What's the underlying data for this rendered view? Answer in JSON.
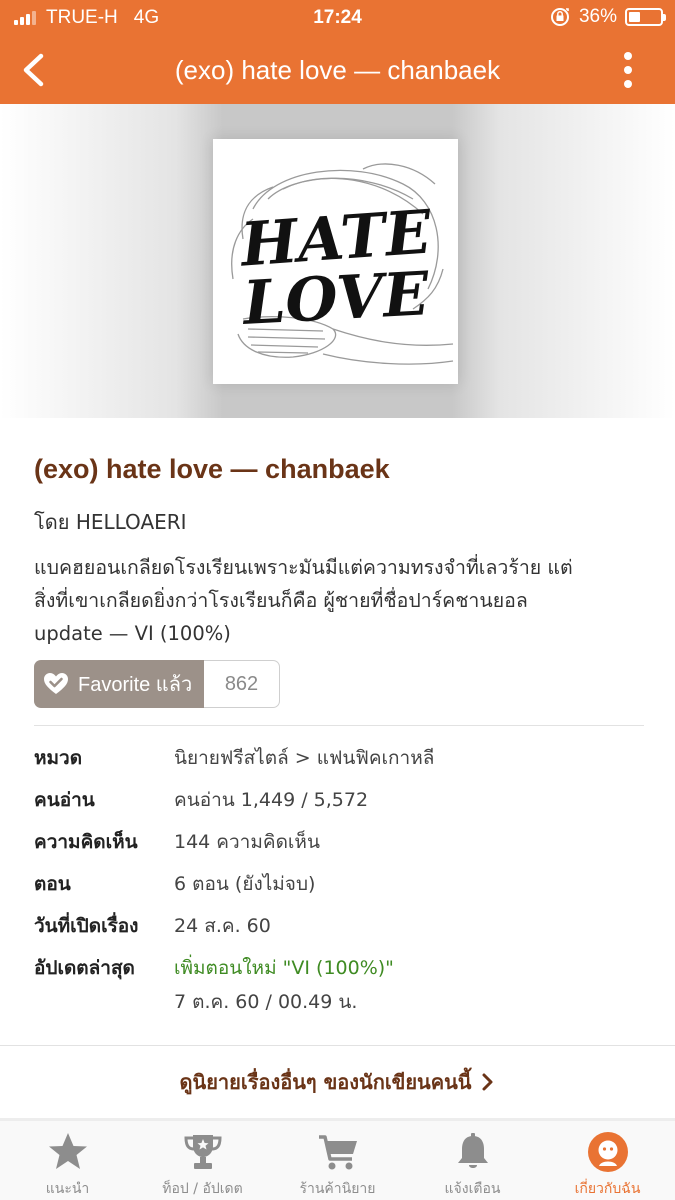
{
  "status_bar": {
    "carrier": "TRUE-H",
    "network": "4G",
    "time": "17:24",
    "battery": "36%",
    "battery_level": 0.36
  },
  "nav": {
    "title": "(exo) hate love — chanbaek",
    "back_icon": "chevron-left-icon",
    "more_icon": "more-vertical-icon"
  },
  "novel": {
    "title": "(exo) hate love — chanbaek",
    "author_prefix": "โดย",
    "author": "HELLOAERI",
    "synopsis_line1": "แบคฮยอนเกลียดโรงเรียนเพราะมันมีแต่ความทรงจำที่เลวร้าย แต่",
    "synopsis_line2": "สิ่งที่เขาเกลียดยิ่งกว่าโรงเรียนก็คือ ผู้ชายที่ชื่อปาร์คชานยอล",
    "synopsis_line3": "update — VI (100%)",
    "favorite_label": "Favorite แล้ว",
    "favorite_count": "862",
    "cover_text_1": "HATE",
    "cover_text_2": "LOVE"
  },
  "details": [
    {
      "label": "หมวด",
      "value": "นิยายฟรีสไตล์ > แฟนฟิคเกาหลี"
    },
    {
      "label": "คนอ่าน",
      "value": "คนอ่าน 1,449 / 5,572"
    },
    {
      "label": "ความคิดเห็น",
      "value": "144 ความคิดเห็น"
    },
    {
      "label": "ตอน",
      "value": "6 ตอน (ยังไม่จบ)"
    },
    {
      "label": "วันที่เปิดเรื่อง",
      "value": "24 ส.ค. 60"
    },
    {
      "label": "อัปเดตล่าสุด",
      "value": "เพิ่มตอนใหม่ \"VI (100%)\"",
      "value2": "7 ต.ค. 60 / 00.49 น."
    }
  ],
  "more_link": "ดูนิยายเรื่องอื่นๆ ของนักเขียนคนนี้",
  "tabs": [
    {
      "label": "แนะนำ",
      "icon": "star-icon"
    },
    {
      "label": "ท็อป / อัปเดต",
      "icon": "trophy-icon"
    },
    {
      "label": "ร้านค้านิยาย",
      "icon": "cart-icon"
    },
    {
      "label": "แจ้งเตือน",
      "icon": "bell-icon"
    },
    {
      "label": "เกี่ยวกับฉัน",
      "icon": "profile-icon"
    }
  ],
  "colors": {
    "accent": "#e97333",
    "title_brown": "#6a3417",
    "update_green": "#3f8b23",
    "favorite_gray": "#9c9189"
  }
}
